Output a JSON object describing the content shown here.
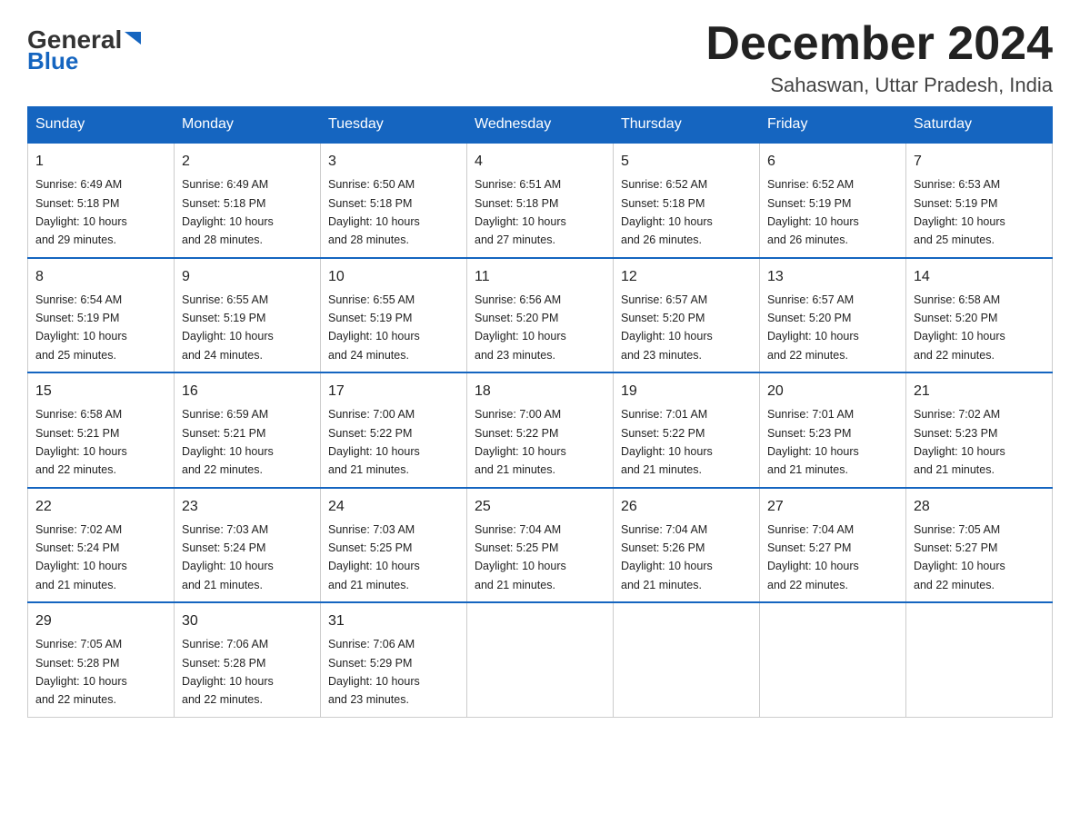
{
  "logo": {
    "text_general": "General",
    "text_blue": "Blue"
  },
  "header": {
    "month_year": "December 2024",
    "location": "Sahaswan, Uttar Pradesh, India"
  },
  "days_of_week": [
    "Sunday",
    "Monday",
    "Tuesday",
    "Wednesday",
    "Thursday",
    "Friday",
    "Saturday"
  ],
  "weeks": [
    [
      {
        "day": "1",
        "sunrise": "6:49 AM",
        "sunset": "5:18 PM",
        "daylight": "10 hours and 29 minutes."
      },
      {
        "day": "2",
        "sunrise": "6:49 AM",
        "sunset": "5:18 PM",
        "daylight": "10 hours and 28 minutes."
      },
      {
        "day": "3",
        "sunrise": "6:50 AM",
        "sunset": "5:18 PM",
        "daylight": "10 hours and 28 minutes."
      },
      {
        "day": "4",
        "sunrise": "6:51 AM",
        "sunset": "5:18 PM",
        "daylight": "10 hours and 27 minutes."
      },
      {
        "day": "5",
        "sunrise": "6:52 AM",
        "sunset": "5:18 PM",
        "daylight": "10 hours and 26 minutes."
      },
      {
        "day": "6",
        "sunrise": "6:52 AM",
        "sunset": "5:19 PM",
        "daylight": "10 hours and 26 minutes."
      },
      {
        "day": "7",
        "sunrise": "6:53 AM",
        "sunset": "5:19 PM",
        "daylight": "10 hours and 25 minutes."
      }
    ],
    [
      {
        "day": "8",
        "sunrise": "6:54 AM",
        "sunset": "5:19 PM",
        "daylight": "10 hours and 25 minutes."
      },
      {
        "day": "9",
        "sunrise": "6:55 AM",
        "sunset": "5:19 PM",
        "daylight": "10 hours and 24 minutes."
      },
      {
        "day": "10",
        "sunrise": "6:55 AM",
        "sunset": "5:19 PM",
        "daylight": "10 hours and 24 minutes."
      },
      {
        "day": "11",
        "sunrise": "6:56 AM",
        "sunset": "5:20 PM",
        "daylight": "10 hours and 23 minutes."
      },
      {
        "day": "12",
        "sunrise": "6:57 AM",
        "sunset": "5:20 PM",
        "daylight": "10 hours and 23 minutes."
      },
      {
        "day": "13",
        "sunrise": "6:57 AM",
        "sunset": "5:20 PM",
        "daylight": "10 hours and 22 minutes."
      },
      {
        "day": "14",
        "sunrise": "6:58 AM",
        "sunset": "5:20 PM",
        "daylight": "10 hours and 22 minutes."
      }
    ],
    [
      {
        "day": "15",
        "sunrise": "6:58 AM",
        "sunset": "5:21 PM",
        "daylight": "10 hours and 22 minutes."
      },
      {
        "day": "16",
        "sunrise": "6:59 AM",
        "sunset": "5:21 PM",
        "daylight": "10 hours and 22 minutes."
      },
      {
        "day": "17",
        "sunrise": "7:00 AM",
        "sunset": "5:22 PM",
        "daylight": "10 hours and 21 minutes."
      },
      {
        "day": "18",
        "sunrise": "7:00 AM",
        "sunset": "5:22 PM",
        "daylight": "10 hours and 21 minutes."
      },
      {
        "day": "19",
        "sunrise": "7:01 AM",
        "sunset": "5:22 PM",
        "daylight": "10 hours and 21 minutes."
      },
      {
        "day": "20",
        "sunrise": "7:01 AM",
        "sunset": "5:23 PM",
        "daylight": "10 hours and 21 minutes."
      },
      {
        "day": "21",
        "sunrise": "7:02 AM",
        "sunset": "5:23 PM",
        "daylight": "10 hours and 21 minutes."
      }
    ],
    [
      {
        "day": "22",
        "sunrise": "7:02 AM",
        "sunset": "5:24 PM",
        "daylight": "10 hours and 21 minutes."
      },
      {
        "day": "23",
        "sunrise": "7:03 AM",
        "sunset": "5:24 PM",
        "daylight": "10 hours and 21 minutes."
      },
      {
        "day": "24",
        "sunrise": "7:03 AM",
        "sunset": "5:25 PM",
        "daylight": "10 hours and 21 minutes."
      },
      {
        "day": "25",
        "sunrise": "7:04 AM",
        "sunset": "5:25 PM",
        "daylight": "10 hours and 21 minutes."
      },
      {
        "day": "26",
        "sunrise": "7:04 AM",
        "sunset": "5:26 PM",
        "daylight": "10 hours and 21 minutes."
      },
      {
        "day": "27",
        "sunrise": "7:04 AM",
        "sunset": "5:27 PM",
        "daylight": "10 hours and 22 minutes."
      },
      {
        "day": "28",
        "sunrise": "7:05 AM",
        "sunset": "5:27 PM",
        "daylight": "10 hours and 22 minutes."
      }
    ],
    [
      {
        "day": "29",
        "sunrise": "7:05 AM",
        "sunset": "5:28 PM",
        "daylight": "10 hours and 22 minutes."
      },
      {
        "day": "30",
        "sunrise": "7:06 AM",
        "sunset": "5:28 PM",
        "daylight": "10 hours and 22 minutes."
      },
      {
        "day": "31",
        "sunrise": "7:06 AM",
        "sunset": "5:29 PM",
        "daylight": "10 hours and 23 minutes."
      },
      null,
      null,
      null,
      null
    ]
  ],
  "labels": {
    "sunrise": "Sunrise:",
    "sunset": "Sunset:",
    "daylight": "Daylight:"
  },
  "colors": {
    "header_bg": "#1565c0",
    "header_text": "#ffffff",
    "border": "#1565c0"
  }
}
